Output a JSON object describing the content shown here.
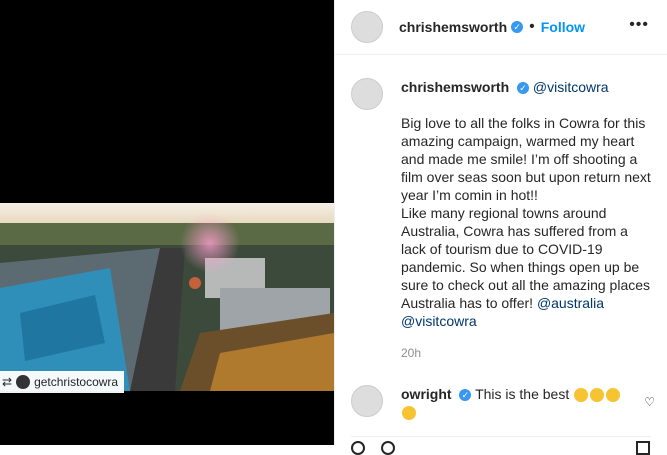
{
  "repost": {
    "account": "getchristocowra"
  },
  "post_header": {
    "username": "chrishemsworth",
    "dot": "•",
    "follow_label": "Follow",
    "more_label": "•••"
  },
  "caption": {
    "username": "chrishemsworth",
    "mention": "@visitcowra",
    "text": "Big love to all the folks in Cowra for this amazing campaign, warmed my heart and made me smile! I’m off shooting a film over seas soon but upon return next year I’m comin in hot!!\nLike many regional towns around Australia, Cowra has suffered from a lack of tourism due to COVID-19 pandemic. So when things open up be sure to check out all the amazing places Australia has to offer! ",
    "tag1": "@australia",
    "tag2": "@visitcowra",
    "time": "20h"
  },
  "comment": {
    "username": "owright",
    "text": "This is the best"
  },
  "colors": {
    "link": "#0095f6",
    "mention": "#00376b",
    "verified": "#3897f0"
  },
  "icons": [
    "verified-icon",
    "heart-icon",
    "more-icon",
    "repost-icon"
  ]
}
